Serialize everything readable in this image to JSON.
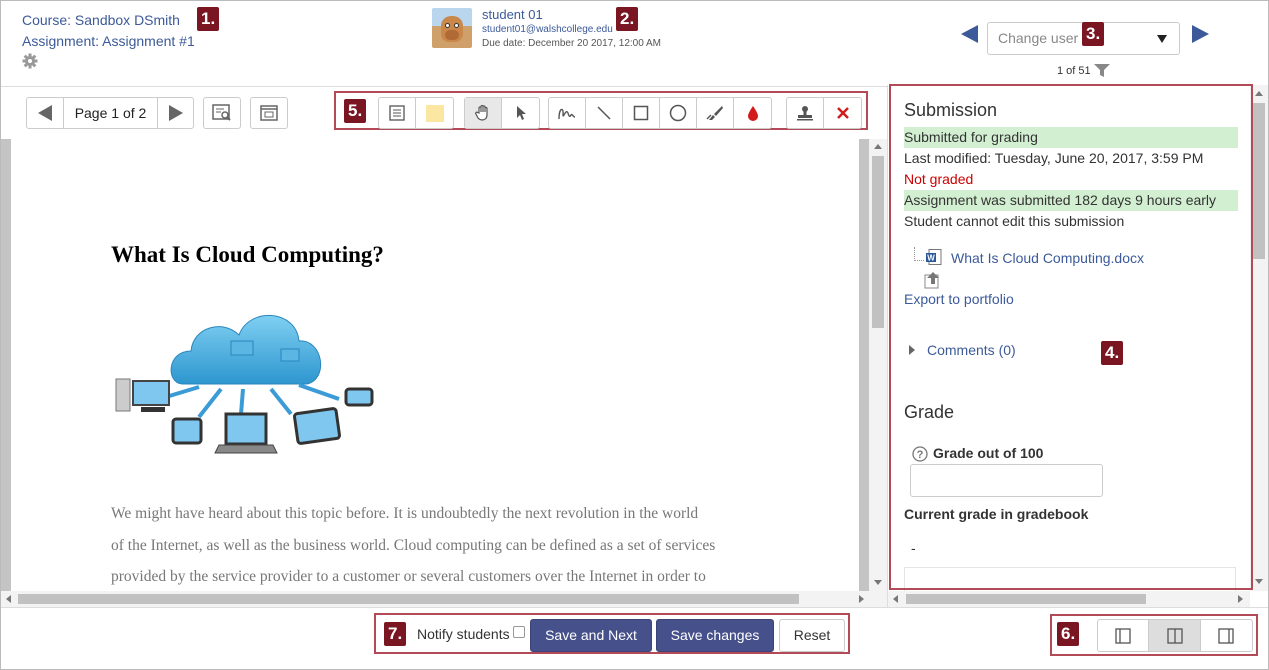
{
  "course": {
    "course_label": "Course: Sandbox DSmith",
    "assignment_label": "Assignment: Assignment #1"
  },
  "student": {
    "name": "student 01",
    "email": "student01@walshcollege.edu",
    "due": "Due date: December 20 2017, 12:00 AM"
  },
  "user_nav": {
    "change_user_placeholder": "Change user",
    "count": "1 of 51"
  },
  "pager": {
    "page_label": "Page 1 of 2"
  },
  "document": {
    "title": "What Is Cloud Computing?",
    "lines": [
      "We might have heard about this topic before. It is undoubtedly the next revolution in the world",
      "of the Internet, as well as the business world. Cloud computing can be defined as a set of services",
      "provided by the service provider to a customer or several customers over the Internet in order to"
    ]
  },
  "submission": {
    "heading": "Submission",
    "status": "Submitted for grading",
    "last_modified": "Last modified: Tuesday, June 20, 2017, 3:59 PM",
    "grading_status": "Not graded",
    "timing": "Assignment was submitted 182 days 9 hours early",
    "edit_status": "Student cannot edit this submission",
    "file_name": "What Is Cloud Computing.docx",
    "export_label": "Export to portfolio",
    "comments_label": "Comments (0)"
  },
  "grade": {
    "heading": "Grade",
    "grade_label": "Grade out of 100",
    "current_label": "Current grade in gradebook",
    "current_value": "-"
  },
  "footer": {
    "notify_label": "Notify students",
    "save_next_label": "Save and Next",
    "save_label": "Save changes",
    "reset_label": "Reset"
  },
  "badges": [
    "1.",
    "2.",
    "3.",
    "4.",
    "5.",
    "6.",
    "7."
  ],
  "colors": {
    "accent": "#3c5a9a",
    "button_blue": "#46518c",
    "badge": "#7a1522",
    "highlight_box": "#b34a57",
    "success_bg": "#d3efd1",
    "error": "#cc0000"
  }
}
